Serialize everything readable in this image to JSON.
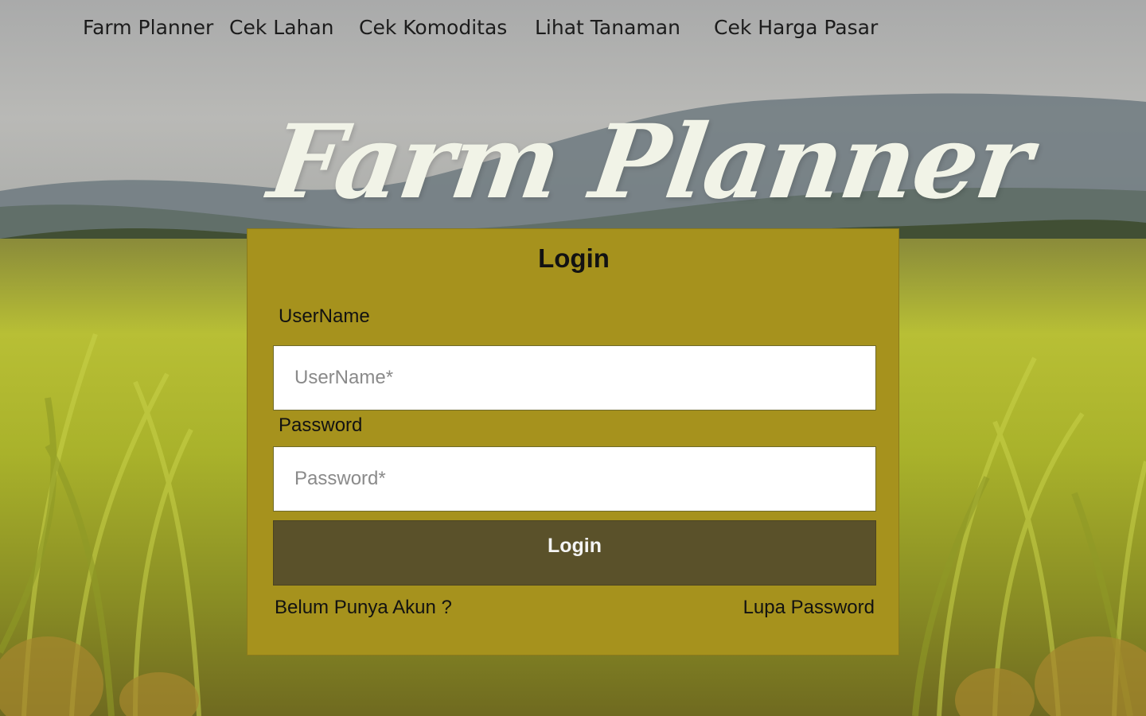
{
  "nav": {
    "items": [
      "Farm Planner",
      "Cek Lahan",
      "Cek Komoditas",
      "Lihat Tanaman",
      "Cek Harga Pasar"
    ]
  },
  "hero": {
    "title": "Farm Planner"
  },
  "login": {
    "title": "Login",
    "username_label": "UserName",
    "username_placeholder": "UserName*",
    "username_value": "",
    "password_label": "Password",
    "password_placeholder": "Password*",
    "password_value": "",
    "submit_label": "Login",
    "register_link": "Belum Punya Akun ?",
    "forgot_link": "Lupa Password"
  },
  "colors": {
    "card_bg": "#a6921d",
    "button_bg": "#5a512a",
    "title_color": "#f1f3e7"
  }
}
